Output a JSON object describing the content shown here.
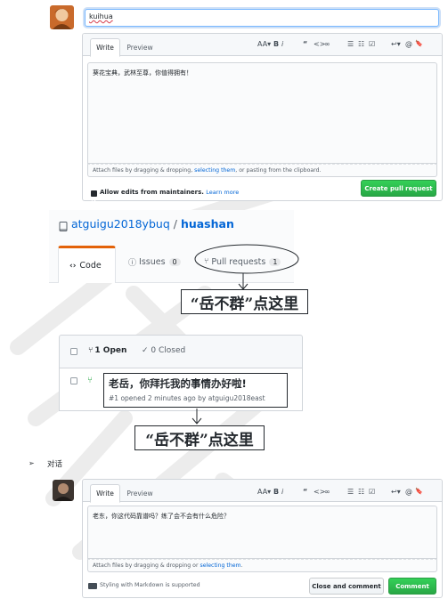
{
  "pr_form": {
    "title_value": "kuihua",
    "tabs": [
      "Write",
      "Preview"
    ],
    "toolbar": [
      "AA▾",
      "B",
      "i",
      "“",
      "<>",
      "∞",
      "☰",
      "☷",
      "☑",
      "↩▾",
      "@",
      "🔖"
    ],
    "body_text": "葵花宝典，武林至尊，你值得拥有！",
    "attach_prefix": "Attach files by dragging & dropping, ",
    "attach_link": "selecting them",
    "attach_suffix": ", or pasting from the clipboard.",
    "allow_edits_label": "Allow edits from maintainers.",
    "learn_more": "Learn more",
    "submit_label": "Create pull request"
  },
  "repo": {
    "owner": "atguigu2018ybuq",
    "slash": "/",
    "name": "huashan",
    "tabs": [
      {
        "label": "Code"
      },
      {
        "label": "Issues",
        "count": "0"
      },
      {
        "label": "Pull requests",
        "count": "1"
      }
    ]
  },
  "callout_1": "“岳不群”点这里",
  "pr_list": {
    "open_label": "1 Open",
    "closed_label": "0 Closed",
    "item_title": "老岳，你拜托我的事情办好啦!",
    "item_meta": "#1 opened 2 minutes ago by atguigu2018east"
  },
  "callout_2": "“岳不群”点这里",
  "section_heading": "对话",
  "comment_form": {
    "tabs": [
      "Write",
      "Preview"
    ],
    "toolbar": [
      "AA▾",
      "B",
      "i",
      "“",
      "<>",
      "∞",
      "☰",
      "☷",
      "☑",
      "↩▾",
      "@",
      "🔖"
    ],
    "body_text": "老东，你这代码靠谱吗？练了会不会有什么危险？",
    "attach_prefix": "Attach files by dragging & dropping or ",
    "attach_link": "selecting them",
    "attach_suffix": ".",
    "markdown_note": "Styling with Markdown is supported",
    "close_label": "Close and comment",
    "comment_label": "Comment"
  },
  "colors": {
    "accent_blue": "#0366d6",
    "green": "#28a745",
    "orange_tab": "#e36209"
  }
}
